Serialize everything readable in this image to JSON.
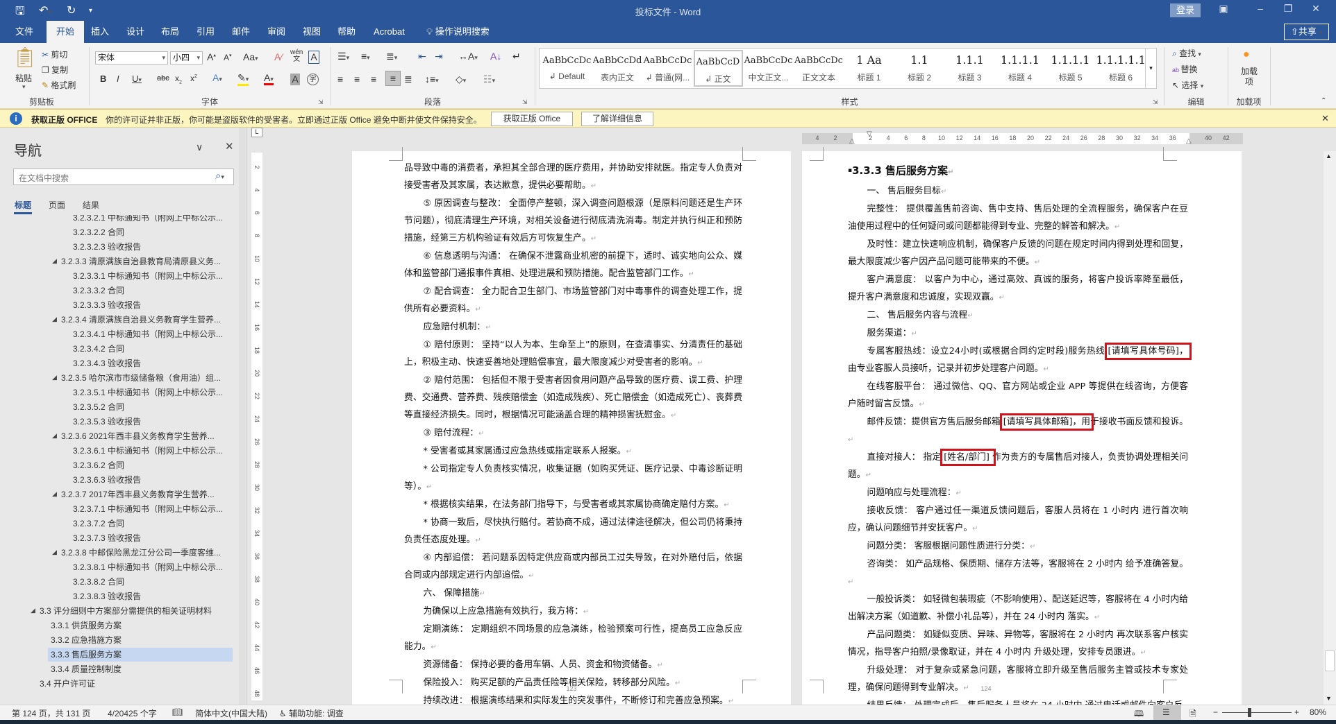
{
  "titlebar": {
    "title": "投标文件 - Word",
    "login": "登录",
    "icons": [
      "save-icon",
      "undo-icon",
      "redo-icon",
      "customize-icon"
    ]
  },
  "tabs": [
    "文件",
    "开始",
    "插入",
    "设计",
    "布局",
    "引用",
    "邮件",
    "审阅",
    "视图",
    "帮助",
    "Acrobat"
  ],
  "active_tab": "开始",
  "tell_me": "操作说明搜索",
  "share": "共享",
  "ribbon": {
    "clipboard": {
      "label": "剪贴板",
      "paste": "粘贴",
      "cut": "剪切",
      "copy": "复制",
      "format_painter": "格式刷"
    },
    "font": {
      "label": "字体",
      "name": "宋体",
      "size": "小四"
    },
    "paragraph": {
      "label": "段落"
    },
    "styles": {
      "label": "样式",
      "items": [
        {
          "preview": "AaBbCcDc",
          "name": "↲ Default"
        },
        {
          "preview": "AaBbCcDdI",
          "name": "表内正文"
        },
        {
          "preview": "AaBbCcDc",
          "name": "↲ 普通(网..."
        },
        {
          "preview": "AaBbCcD",
          "name": "↲ 正文"
        },
        {
          "preview": "AaBbCcDc",
          "name": "中文正文..."
        },
        {
          "preview": "AaBbCcDc",
          "name": "正文文本"
        },
        {
          "preview": "1  Aa",
          "name": "标题 1"
        },
        {
          "preview": "1.1",
          "name": "标题 2"
        },
        {
          "preview": "1.1.1",
          "name": "标题 3"
        },
        {
          "preview": "1.1.1.1",
          "name": "标题 4"
        },
        {
          "preview": "1.1.1.1",
          "name": "标题 5"
        },
        {
          "preview": "1.1.1.1.1",
          "name": "标题 6"
        }
      ],
      "selected": 3
    },
    "editing": {
      "label": "编辑",
      "find": "查找",
      "replace": "替换",
      "select": "选择"
    },
    "addins": {
      "label": "加载项",
      "button": "加载项"
    }
  },
  "infobar": {
    "title": "获取正版 OFFICE",
    "message": "你的许可证并非正版，你可能是盗版软件的受害者。立即通过正版 Office 避免中断并使文件保持安全。",
    "btn_get": "获取正版 Office",
    "btn_learn": "了解详细信息"
  },
  "nav": {
    "title": "导航",
    "search_placeholder": "在文档中搜索",
    "tabs": [
      "标题",
      "页面",
      "结果"
    ],
    "items": [
      {
        "text": "3.2.3.2.1 中标通知书（附网上中标公示...",
        "level": 5
      },
      {
        "text": "3.2.3.2.2 合同",
        "level": 5
      },
      {
        "text": "3.2.3.2.3 验收报告",
        "level": 5
      },
      {
        "text": "3.2.3.3 清原满族自治县教育局清原县义务...",
        "level": 4
      },
      {
        "text": "3.2.3.3.1 中标通知书（附网上中标公示...",
        "level": 5
      },
      {
        "text": "3.2.3.3.2 合同",
        "level": 5
      },
      {
        "text": "3.2.3.3.3 验收报告",
        "level": 5
      },
      {
        "text": "3.2.3.4 清原满族自治县义务教育学生营养...",
        "level": 4
      },
      {
        "text": "3.2.3.4.1 中标通知书（附网上中标公示...",
        "level": 5
      },
      {
        "text": "3.2.3.4.2 合同",
        "level": 5
      },
      {
        "text": "3.2.3.4.3 验收报告",
        "level": 5
      },
      {
        "text": "3.2.3.5 哈尔滨市市级储备粮（食用油）组...",
        "level": 4
      },
      {
        "text": "3.2.3.5.1 中标通知书（附网上中标公示...",
        "level": 5
      },
      {
        "text": "3.2.3.5.2 合同",
        "level": 5
      },
      {
        "text": "3.2.3.5.3 验收报告",
        "level": 5
      },
      {
        "text": "3.2.3.6 2021年西丰县义务教育学生营养...",
        "level": 4
      },
      {
        "text": "3.2.3.6.1 中标通知书（附网上中标公示...",
        "level": 5
      },
      {
        "text": "3.2.3.6.2 合同",
        "level": 5
      },
      {
        "text": "3.2.3.6.3 验收报告",
        "level": 5
      },
      {
        "text": "3.2.3.7 2017年西丰县义务教育学生营养...",
        "level": 4
      },
      {
        "text": "3.2.3.7.1 中标通知书（附网上中标公示...",
        "level": 5
      },
      {
        "text": "3.2.3.7.2 合同",
        "level": 5
      },
      {
        "text": "3.2.3.7.3 验收报告",
        "level": 5
      },
      {
        "text": "3.2.3.8 中邮保险黑龙江分公司一季度客维...",
        "level": 4
      },
      {
        "text": "3.2.3.8.1 中标通知书（附网上中标公示...",
        "level": 5
      },
      {
        "text": "3.2.3.8.2 合同",
        "level": 5
      },
      {
        "text": "3.2.3.8.3 验收报告",
        "level": 5
      },
      {
        "text": "3.3 评分细则中方案部分需提供的相关证明材料",
        "level": 2
      },
      {
        "text": "3.3.1 供货服务方案",
        "level": 3
      },
      {
        "text": "3.3.2 应急措施方案",
        "level": 3
      },
      {
        "text": "3.3.3 售后服务方案",
        "level": 3,
        "selected": true
      },
      {
        "text": "3.3.4 质量控制制度",
        "level": 3
      },
      {
        "text": "3.4 开户许可证",
        "level": 2
      }
    ]
  },
  "rulers": {
    "horizontal": [
      "4",
      "2",
      "2",
      "4",
      "6",
      "8",
      "10",
      "12",
      "14",
      "16",
      "18",
      "20",
      "22",
      "24",
      "26",
      "28",
      "30",
      "32",
      "34",
      "36",
      "40",
      "42"
    ],
    "vertical": [
      "2",
      "4",
      "6",
      "8",
      "10",
      "12",
      "14",
      "16",
      "18",
      "20",
      "22",
      "24",
      "26",
      "28",
      "30",
      "32",
      "34",
      "36",
      "38",
      "40",
      "42",
      "44",
      "46",
      "48"
    ]
  },
  "left_page": {
    "page_number": "123",
    "paragraphs": [
      {
        "text": "品导致中毒的消费者，承担其全部合理的医疗费用，并协助安排就医。指定专人负责对接受害者及其家属，表达歉意，提供必要帮助。",
        "indent": false
      },
      {
        "text": "⑤ 原因调查与整改： 全面停产整顿，深入调查问题根源（是原料问题还是生产环节问题），彻底清理生产环境，对相关设备进行彻底清洗消毒。制定并执行纠正和预防措施，经第三方机构验证有效后方可恢复生产。",
        "indent": true
      },
      {
        "text": "⑥ 信息透明与沟通： 在确保不泄露商业机密的前提下，适时、诚实地向公众、媒体和监管部门通报事件真相、处理进展和预防措施。配合监管部门工作。",
        "indent": true
      },
      {
        "text": "⑦ 配合调查： 全力配合卫生部门、市场监管部门对中毒事件的调查处理工作，提供所有必要资料。",
        "indent": true
      },
      {
        "text": "应急赔付机制：",
        "indent": true
      },
      {
        "text": "① 赔付原则： 坚持“以人为本、生命至上”的原则，在查清事实、分清责任的基础上，积极主动、快速妥善地处理赔偿事宜，最大限度减少对受害者的影响。",
        "indent": true
      },
      {
        "text": "② 赔付范围： 包括但不限于受害者因食用问题产品导致的医疗费、误工费、护理费、交通费、营养费、残疾赔偿金（如造成残疾）、死亡赔偿金（如造成死亡）、丧葬费等直接经济损失。同时，根据情况可能涵盖合理的精神损害抚慰金。",
        "indent": true
      },
      {
        "text": "③ 赔付流程：",
        "indent": true
      },
      {
        "text": "* 受害者或其家属通过应急热线或指定联系人报案。",
        "indent": true
      },
      {
        "text": "* 公司指定专人负责核实情况，收集证据（如购买凭证、医疗记录、中毒诊断证明等）。",
        "indent": true
      },
      {
        "text": "* 根据核实结果，在法务部门指导下，与受害者或其家属协商确定赔付方案。",
        "indent": true
      },
      {
        "text": "* 协商一致后，尽快执行赔付。若协商不成，通过法律途径解决，但公司仍将秉持负责任态度处理。",
        "indent": true
      },
      {
        "text": "④ 内部追偿： 若问题系因特定供应商或内部员工过失导致，在对外赔付后，依据合同或内部规定进行内部追偿。",
        "indent": true
      },
      {
        "text": "六、 保障措施",
        "indent": true
      },
      {
        "text": "为确保以上应急措施有效执行，我方将：",
        "indent": true
      },
      {
        "text": "定期演练： 定期组织不同场景的应急演练，检验预案可行性，提高员工应急反应能力。",
        "indent": true
      },
      {
        "text": "资源储备： 保持必要的备用车辆、人员、资金和物资储备。",
        "indent": true
      },
      {
        "text": "保险投入： 购买足额的产品责任险等相关保险，转移部分风险。",
        "indent": true
      },
      {
        "text": "持续改进： 根据演练结果和实际发生的突发事件，不断修订和完善应急预案。",
        "indent": true
      }
    ]
  },
  "right_page": {
    "page_number": "124",
    "heading": "3.3.3 售后服务方案",
    "paragraphs": [
      {
        "parts": [
          "一、 售后服务目标"
        ]
      },
      {
        "parts": [
          "完整性： 提供覆盖售前咨询、售中支持、售后处理的全流程服务，确保客户在豆油使用过程中的任何疑问或问题都能得到专业、完整的解答和解决。"
        ]
      },
      {
        "parts": [
          "及时性：建立快速响应机制，确保客户反馈的问题在规定时间内得到处理和回复，最大限度减少客户因产品问题可能带来的不便。"
        ]
      },
      {
        "parts": [
          "客户满意度： 以客户为中心，通过高效、真诚的服务，将客户投诉率降至最低，提升客户满意度和忠诚度，实现双赢。"
        ]
      },
      {
        "parts": [
          "二、 售后服务内容与流程"
        ]
      },
      {
        "parts": [
          "服务渠道："
        ]
      },
      {
        "parts": [
          "专属客服热线：设立24小时(或根据合同约定时段)服务热线 ",
          "[请填写具体号码]，",
          "由专业客服人员接听，记录并初步处理客户问题。"
        ],
        "highlight": 1
      },
      {
        "parts": [
          "在线客服平台： 通过微信、QQ、官方网站或企业 APP 等提供在线咨询，方便客户随时留言反馈。"
        ]
      },
      {
        "parts": [
          "邮件反馈：提供官方售后服务邮箱 ",
          "[请填写具体邮箱]，用",
          "于接收书面反馈和投诉。"
        ],
        "highlight": 1
      },
      {
        "parts": [
          "直接对接人： 指定 ",
          "[姓名/部门] ",
          "作为贵方的专属售后对接人，负责协调处理相关问题。"
        ],
        "highlight": 1
      },
      {
        "parts": [
          "问题响应与处理流程："
        ]
      },
      {
        "parts": [
          "接收反馈： 客户通过任一渠道反馈问题后，客服人员将在 1 小时内 进行首次响应，确认问题细节并安抚客户。"
        ]
      },
      {
        "parts": [
          "问题分类： 客服根据问题性质进行分类："
        ]
      },
      {
        "parts": [
          "咨询类： 如产品规格、保质期、储存方法等，客服将在 2 小时内 给予准确答复。"
        ]
      },
      {
        "parts": [
          "一般投诉类： 如轻微包装瑕疵（不影响使用）、配送延迟等，客服将在 4 小时内给出解决方案（如道歉、补偿小礼品等），并在 24 小时内 落实。"
        ]
      },
      {
        "parts": [
          "产品问题类： 如疑似变质、异味、异物等，客服将在 2 小时内 再次联系客户核实情况，指导客户拍照/录像取证，并在 4 小时内 升级处理，安排专员跟进。"
        ]
      },
      {
        "parts": [
          "升级处理： 对于复杂或紧急问题，客服将立即升级至售后服务主管或技术专家处理，确保问题得到专业解决。"
        ]
      },
      {
        "parts": [
          "结果反馈： 处理完成后，售后服务人员将在 24 小时内 通过电话或邮件向客户反"
        ],
        "continues": true
      }
    ]
  },
  "statusbar": {
    "page": "第 124 页，共 131 页",
    "words": "4/20425 个字",
    "language": "简体中文(中国大陆)",
    "accessibility": "辅助功能: 调查",
    "zoom": "80%",
    "zoom_percent": 80
  },
  "colors": {
    "brand": "#2b579a",
    "highlight_box": "#d0121b",
    "info_bar": "#fcf5c0",
    "nav_selected": "#c5d7f1"
  }
}
